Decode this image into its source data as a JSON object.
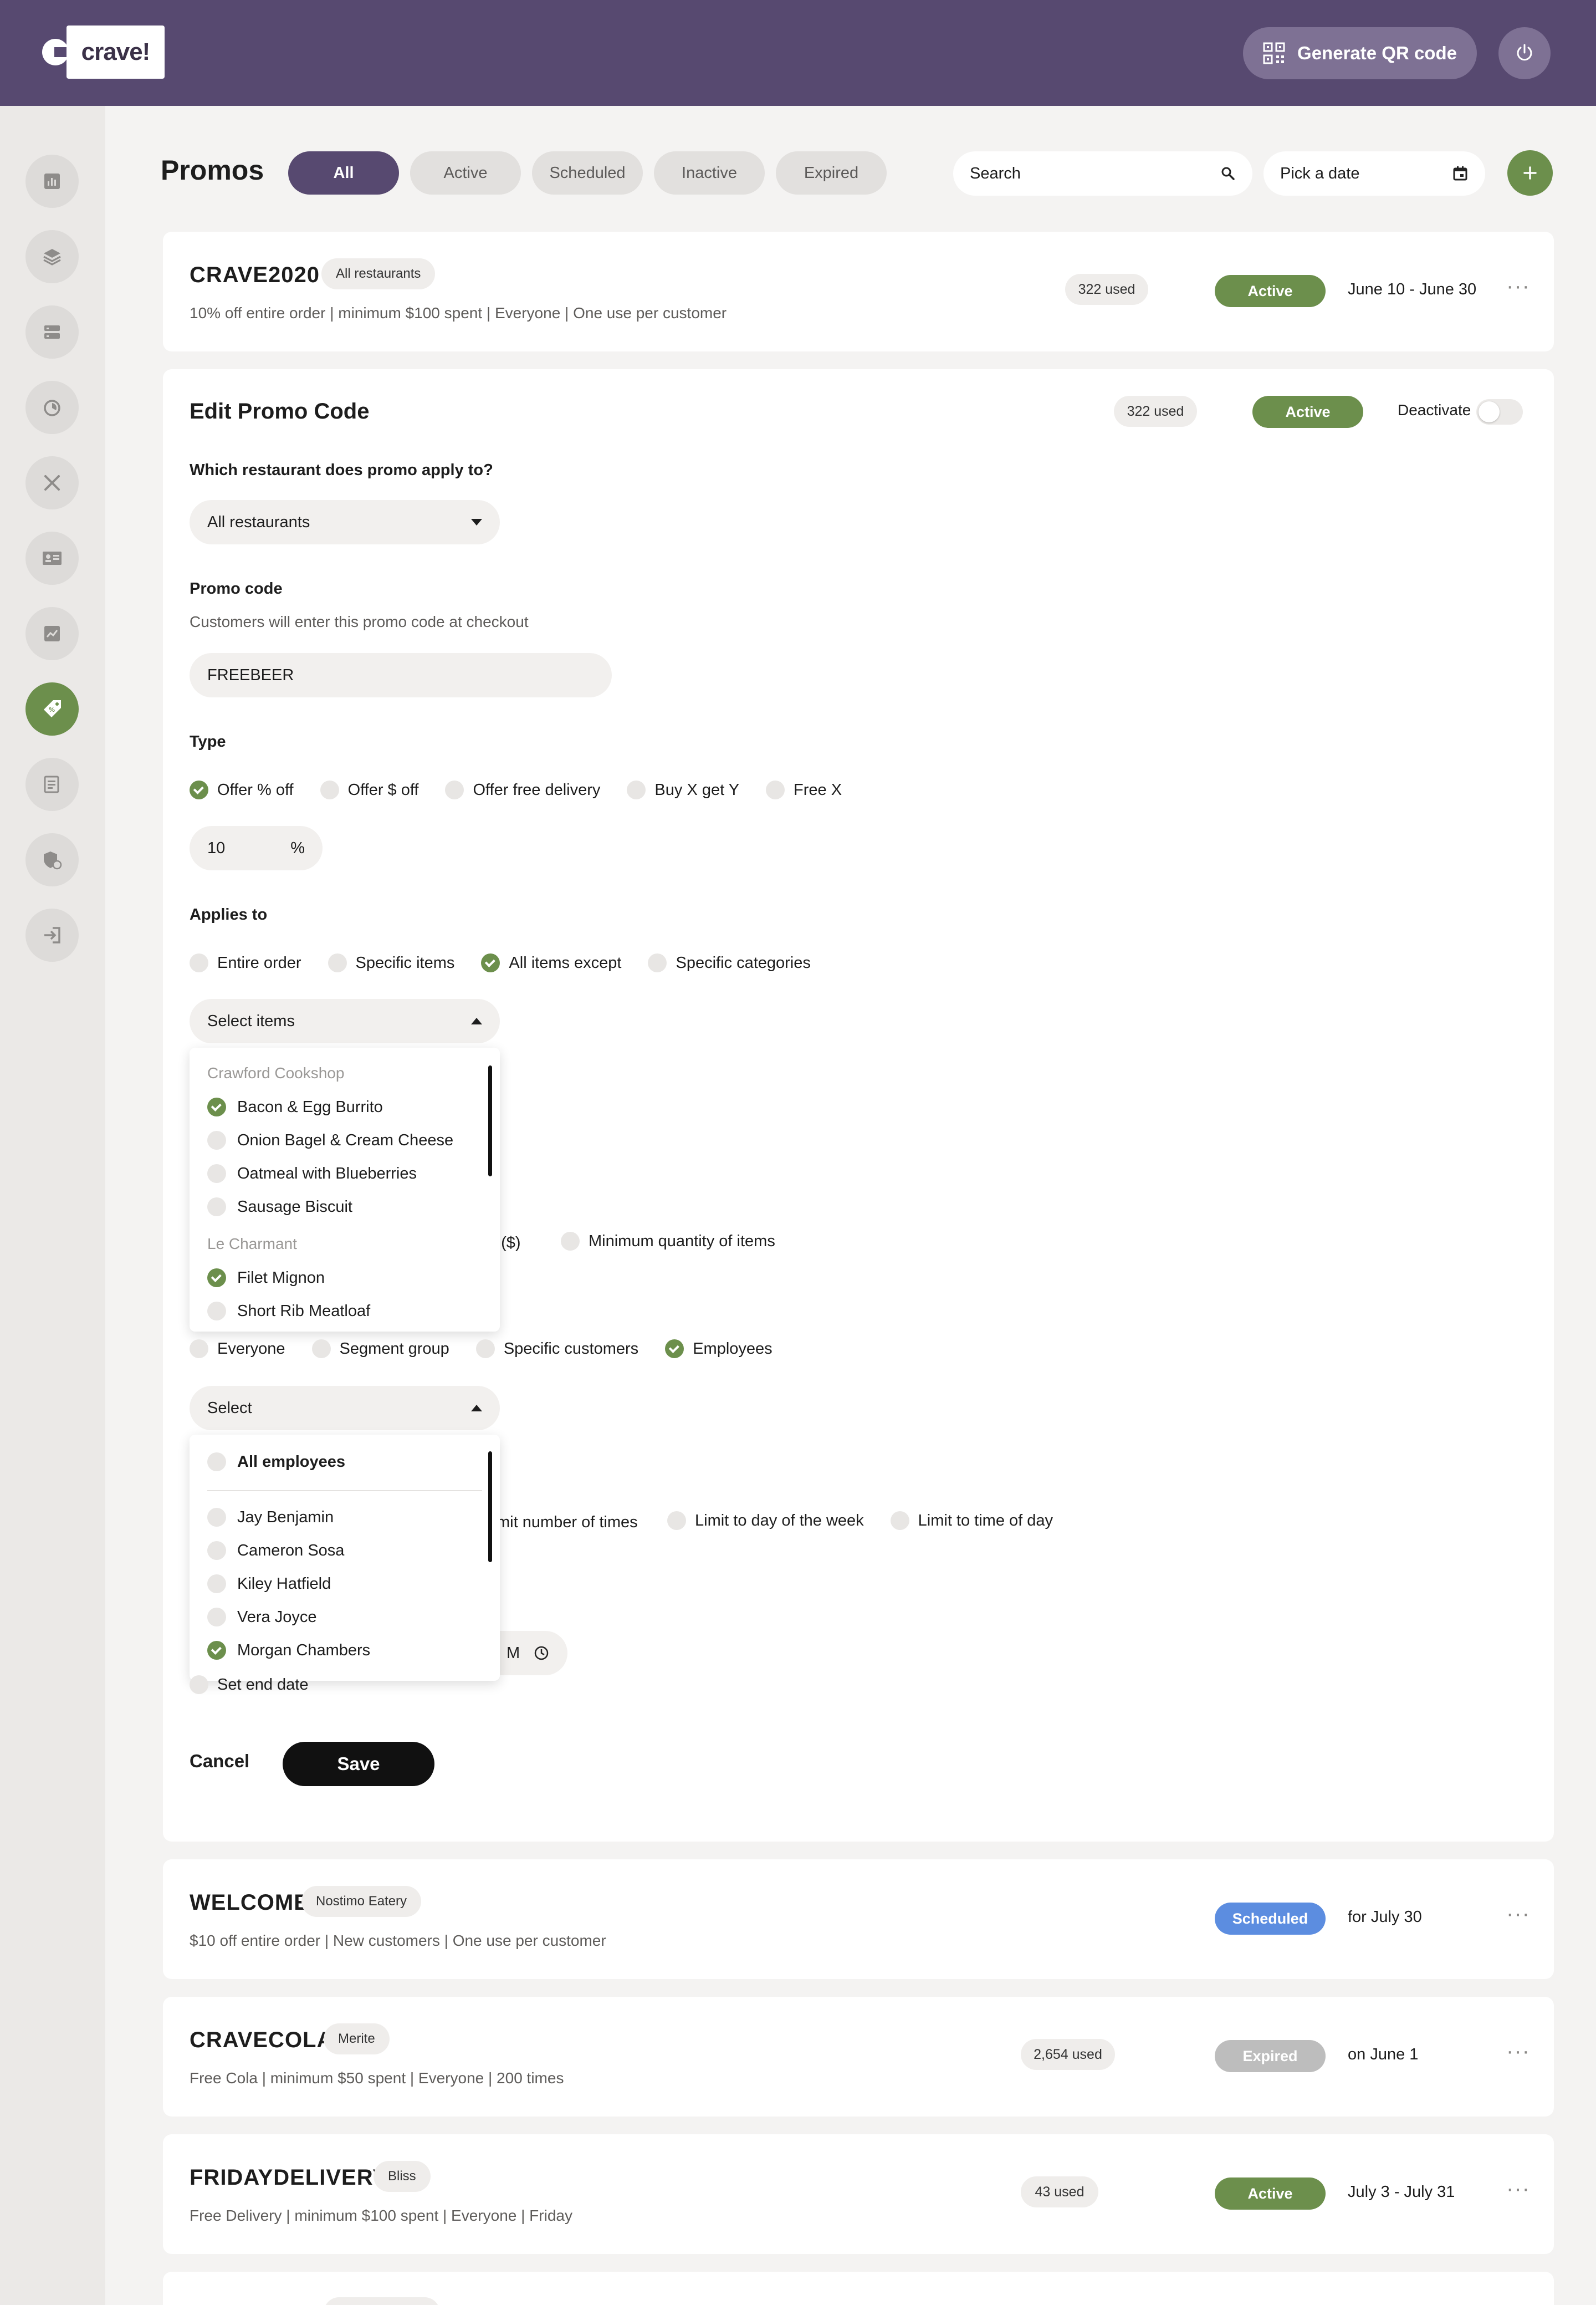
{
  "header": {
    "logo_text": "crave!",
    "qr_button_label": "Generate QR code"
  },
  "page": {
    "title": "Promos",
    "filters": [
      "All",
      "Active",
      "Scheduled",
      "Inactive",
      "Expired"
    ],
    "selected_filter": "All",
    "search_placeholder": "Search",
    "date_placeholder": "Pick a date"
  },
  "sidebar": {
    "items": [
      "dashboard",
      "layers",
      "storage",
      "timer",
      "menu-tools",
      "contact-card",
      "analytics",
      "promos",
      "reports",
      "security",
      "logout"
    ],
    "active": "promos"
  },
  "promos": [
    {
      "code": "CRAVE2020",
      "restaurant": "All restaurants",
      "desc": "10% off entire order | minimum $100 spent | Everyone | One use per customer",
      "used": "322 used",
      "status": "Active",
      "dates": "June 10 - June 30"
    },
    {
      "code": "WELCOME",
      "restaurant": "Nostimo Eatery",
      "desc": "$10 off entire order | New customers | One use per customer",
      "used": "",
      "status": "Scheduled",
      "dates": "for July 30"
    },
    {
      "code": "CRAVECOLA",
      "restaurant": "Merite",
      "desc": "Free Cola | minimum $50 spent | Everyone | 200 times",
      "used": "2,654 used",
      "status": "Expired",
      "dates": "on June 1"
    },
    {
      "code": "FRIDAYDELIVERY",
      "restaurant": "Bliss",
      "desc": "Free Delivery | minimum $100 spent | Everyone | Friday",
      "used": "43 used",
      "status": "Active",
      "dates": "July 3 - July 31"
    }
  ],
  "edit": {
    "title": "Edit Promo Code",
    "used": "322 used",
    "status": "Active",
    "deactivate_label": "Deactivate",
    "restaurant_question": "Which restaurant does promo apply to?",
    "restaurant_value": "All restaurants",
    "promo_code_label": "Promo code",
    "promo_code_help": "Customers will enter this promo code at checkout",
    "promo_code_value": "FREEBEER",
    "type_label": "Type",
    "type_options": [
      "Offer % off",
      "Offer $ off",
      "Offer free delivery",
      "Buy X get Y",
      "Free X"
    ],
    "type_selected": "Offer % off",
    "percent_value": "10",
    "percent_unit": "%",
    "applies_label": "Applies to",
    "applies_options": [
      "Entire order",
      "Specific items",
      "All items except",
      "Specific categories"
    ],
    "applies_selected": "All items except",
    "select_items_label": "Select items",
    "item_groups": [
      {
        "name": "Crawford Cookshop",
        "items": [
          {
            "label": "Bacon & Egg Burrito",
            "checked": true
          },
          {
            "label": "Onion Bagel & Cream Cheese",
            "checked": false
          },
          {
            "label": "Oatmeal with Blueberries",
            "checked": false
          },
          {
            "label": "Sausage Biscuit",
            "checked": false
          }
        ]
      },
      {
        "name": "Le Charmant",
        "items": [
          {
            "label": "Filet Mignon",
            "checked": true
          },
          {
            "label": "Short Rib Meatloaf",
            "checked": false
          }
        ]
      }
    ],
    "requirement_partial": "t ($)",
    "requirement_option": "Minimum quantity of items",
    "customer_options": [
      "Everyone",
      "Segment group",
      "Specific customers",
      "Employees"
    ],
    "customer_selected": "Employees",
    "select_label": "Select",
    "all_employees": "All employees",
    "employees": [
      {
        "label": "Jay Benjamin",
        "checked": false
      },
      {
        "label": "Cameron Sosa",
        "checked": false
      },
      {
        "label": "Kiley Hatfield",
        "checked": false
      },
      {
        "label": "Vera Joyce",
        "checked": false
      },
      {
        "label": "Morgan Chambers",
        "checked": true
      }
    ],
    "limit_partial": "mit number of times",
    "limit_options": [
      "Limit to day of the week",
      "Limit to time of day"
    ],
    "time_partial": "M",
    "end_date_label": "Set end date",
    "cancel_label": "Cancel",
    "save_label": "Save"
  },
  "colors": {
    "header": "#574970",
    "accent_green": "#6c8f4c",
    "scheduled_blue": "#5c8de0",
    "expired_gray": "#bdbdbd"
  }
}
